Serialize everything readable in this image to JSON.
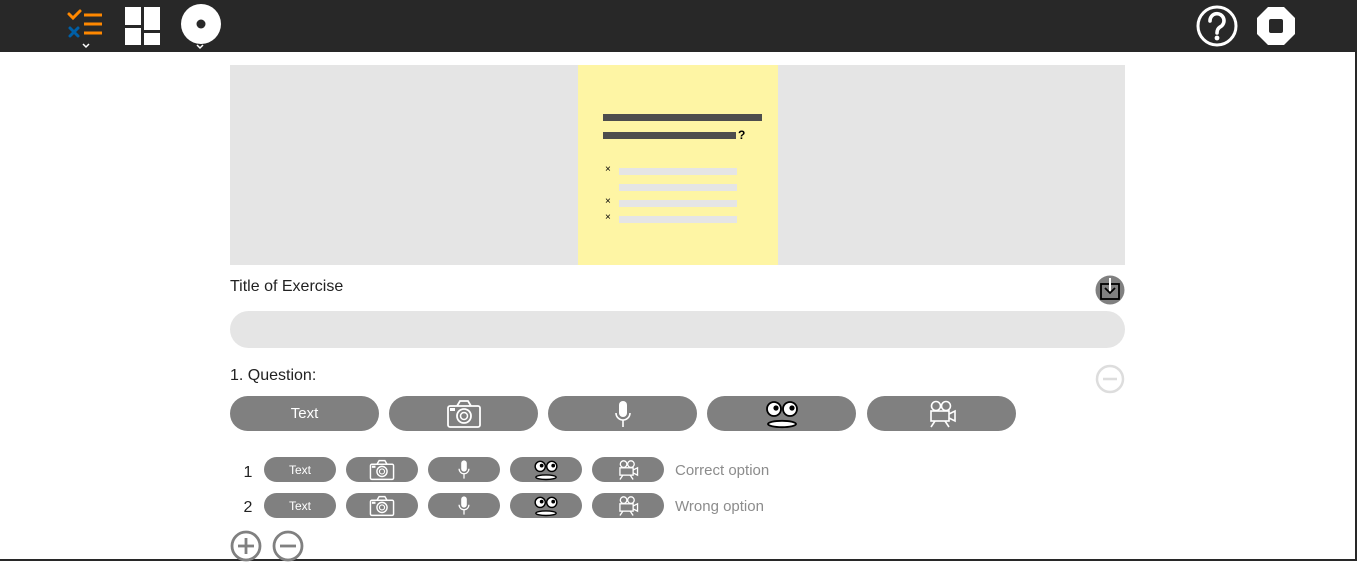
{
  "toolbar": {
    "left_icons": [
      "activity-icon",
      "layout-icon",
      "color-picker-icon"
    ],
    "right_icons": [
      "help-icon",
      "stop-icon"
    ]
  },
  "preview": {
    "question_mark": "?",
    "markers": [
      "×",
      "",
      "×",
      "×"
    ]
  },
  "exercise": {
    "title_label": "Title of Exercise",
    "title_value": "",
    "import_icon": "import-icon"
  },
  "question": {
    "label": "1. Question:",
    "media_buttons": [
      "Text",
      "camera-icon",
      "microphone-icon",
      "speak-face-icon",
      "video-icon"
    ]
  },
  "options": [
    {
      "number": "1",
      "text_label": "Text",
      "placeholder": "Correct option"
    },
    {
      "number": "2",
      "text_label": "Text",
      "placeholder": "Wrong option"
    }
  ],
  "colors": {
    "toolbar": "#282828",
    "accent_orange": "#ff8800",
    "accent_blue": "#005fa6",
    "button_grey": "#808080",
    "preview_bg": "#e5e5e5",
    "note_bg": "#fef5a4"
  }
}
